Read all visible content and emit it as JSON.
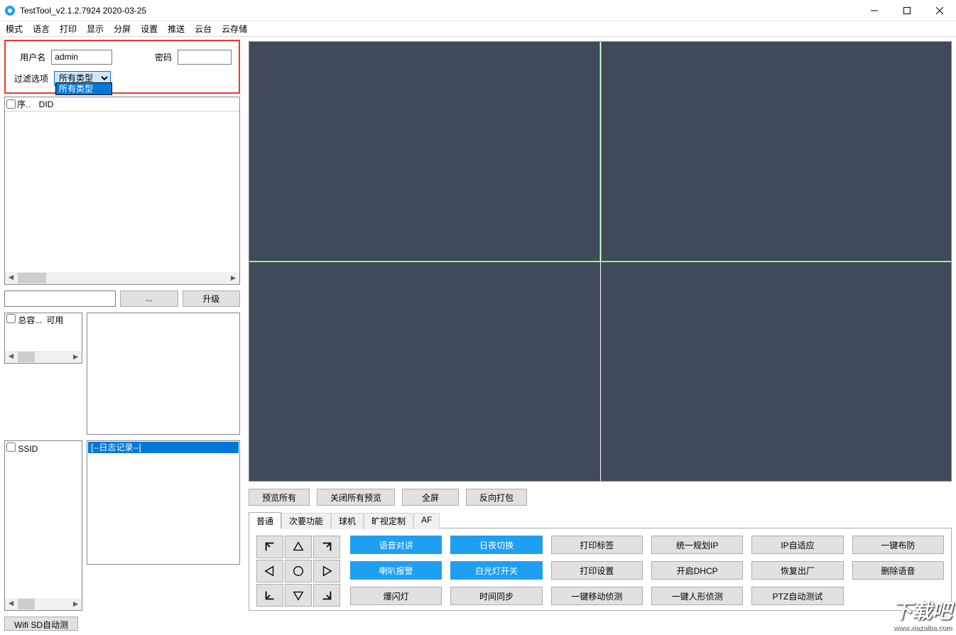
{
  "window": {
    "title": "TestTool_v2.1.2.7924 2020-03-25"
  },
  "menu": [
    "模式",
    "语言",
    "打印",
    "显示",
    "分屏",
    "设置",
    "推送",
    "云台",
    "云存储"
  ],
  "cred": {
    "user_label": "用户名",
    "user_value": "admin",
    "pw_label": "密码",
    "filter_label": "过滤选项",
    "filter_selected": "所有类型",
    "filter_option": "所有类型"
  },
  "devlist": {
    "col1": "序..",
    "col2": "DID"
  },
  "file": {
    "browse": "...",
    "upgrade": "升级"
  },
  "cap": {
    "col1": "总容...",
    "col2": "可用"
  },
  "ssid": {
    "col1": "SSID"
  },
  "log": {
    "line1": "[--日志记录--]"
  },
  "wifi_btn": "Wifi SD自动测",
  "actions": {
    "preview_all": "预览所有",
    "close_all": "关闭所有预览",
    "fullscreen": "全屏",
    "reverse_pack": "反向打包"
  },
  "tabs": [
    "普通",
    "次要功能",
    "球机",
    "旷视定制",
    "AF"
  ],
  "grid": {
    "r0": [
      "语音对讲",
      "日夜切换",
      "打印标签",
      "统一规划IP",
      "IP自适应",
      "一键布防"
    ],
    "r1": [
      "喇叭报警",
      "白光灯开关",
      "打印设置",
      "开启DHCP",
      "恢复出厂",
      "删除语音"
    ],
    "r2": [
      "爆闪灯",
      "时间同步",
      "一键移动侦测",
      "一键人形侦测",
      "PTZ自动测试",
      ""
    ]
  },
  "watermark": {
    "big": "下载吧",
    "small": "www.xiazaiba.com"
  }
}
